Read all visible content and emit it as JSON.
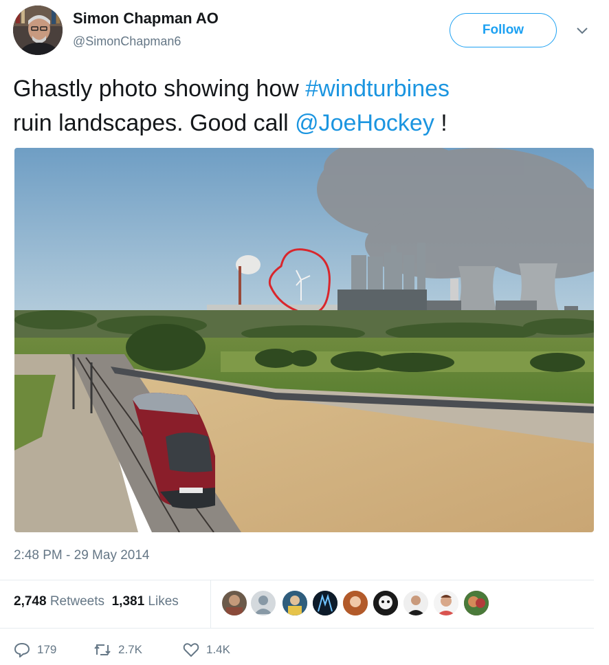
{
  "author": {
    "display_name": "Simon Chapman AO",
    "handle": "@SimonChapman6"
  },
  "follow_label": "Follow",
  "tweet": {
    "text_part1": "Ghastly photo showing how ",
    "hashtag": "#windturbines",
    "text_part2": "ruin landscapes. Good call ",
    "mention": "@JoeHockey",
    "text_part3": " !"
  },
  "timestamp": "2:48 PM - 29 May 2014",
  "stats": {
    "retweets_count": "2,748",
    "retweets_label": "Retweets",
    "likes_count": "1,381",
    "likes_label": "Likes"
  },
  "actions": {
    "replies": "179",
    "retweets": "2.7K",
    "likes": "1.4K"
  },
  "colors": {
    "link": "#1b95e0",
    "follow": "#1da1f2",
    "muted": "#657786",
    "annotation_circle": "#d9262c"
  },
  "photo_subject": "power-station-with-wind-turbine-circled-and-train",
  "liker_avatars": [
    "liker-1",
    "liker-2",
    "liker-3",
    "liker-4",
    "liker-5",
    "liker-6",
    "liker-7",
    "liker-8",
    "liker-9",
    "liker-10"
  ]
}
